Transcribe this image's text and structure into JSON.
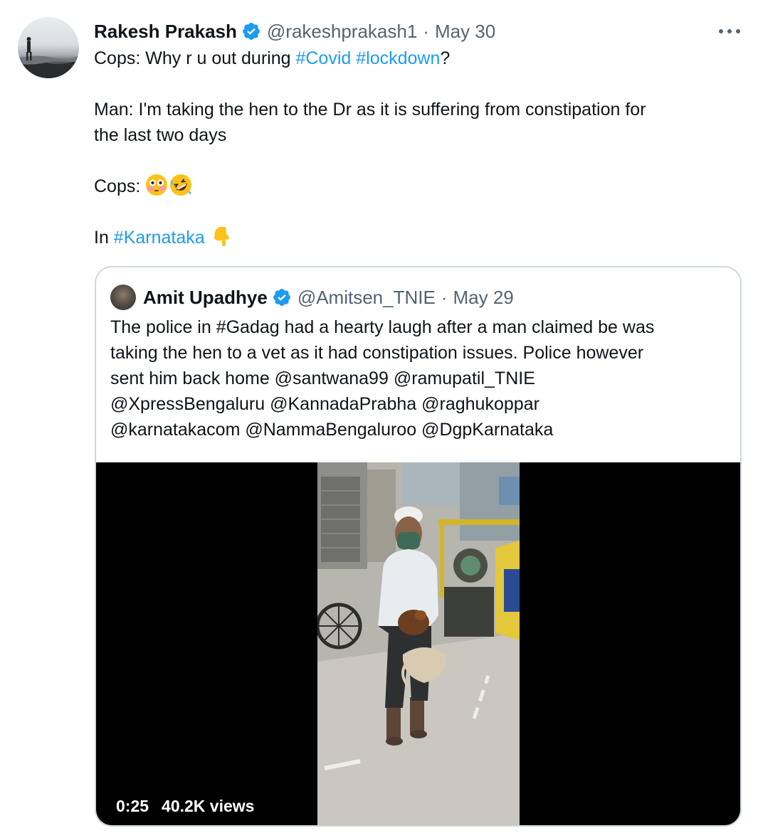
{
  "tweet": {
    "author": {
      "display_name": "Rakesh Prakash",
      "handle": "@rakeshprakash1",
      "verified": true
    },
    "separator": "·",
    "date": "May 30",
    "lines": {
      "l1_prefix": "Cops: Why r u out during ",
      "l1_tag1": "#Covid",
      "l1_tag2": "#lockdown",
      "l1_suffix": "?",
      "l2": "Man: I'm taking the hen to the Dr as it is suffering from constipation for",
      "l3": "the last two days",
      "l4": "Cops: ",
      "l5_prefix": "In ",
      "l5_tag": "#Karnataka"
    },
    "emojis": [
      "flushed-face",
      "rolling-on-floor-laughing",
      "backhand-index-pointing-down"
    ]
  },
  "quoted_tweet": {
    "author": {
      "display_name": "Amit Upadhye",
      "handle": "@Amitsen_TNIE",
      "verified": true
    },
    "separator": "·",
    "date": "May 29",
    "text_lines": [
      "The police in #Gadag had a hearty laugh after a man claimed be was",
      "taking the hen to a vet as it had constipation issues. Police however",
      "sent him back home @santwana99 @ramupatil_TNIE",
      "@XpressBengaluru @KannadaPrabha @raghukoppar",
      "@karnatakacom @NammaBengaluroo @DgpKarnataka"
    ],
    "video": {
      "duration": "0:25",
      "views": "40.2K views"
    }
  },
  "colors": {
    "link": "#1d9bf0",
    "text": "#0f1419",
    "secondary": "#536471",
    "border": "#cfd9de",
    "verified": "#1d9bf0"
  }
}
